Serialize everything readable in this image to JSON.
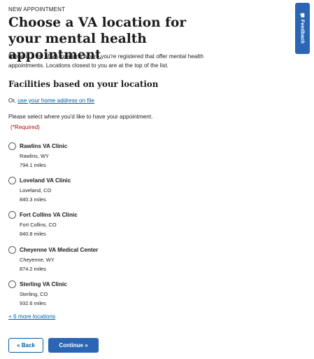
{
  "header": {
    "eyebrow": "NEW APPOINTMENT",
    "title": "Choose a VA location for your mental health appointment",
    "intro": "Below is a list of VA locations where you're registered that offer mental health appointments. Locations closest to you are at the top of the list."
  },
  "section": {
    "title": "Facilities based on your location",
    "or_prefix": "Or, ",
    "home_address_link": "use your home address on file",
    "prompt": "Please select where you'd like to have your appointment.",
    "required": "(*Required)"
  },
  "facilities": [
    {
      "name": "Rawlins VA Clinic",
      "location": "Rawlins, WY",
      "distance": "794.1 miles",
      "selected": false
    },
    {
      "name": "Loveland VA Clinic",
      "location": "Loveland, CO",
      "distance": "840.3 miles",
      "selected": false
    },
    {
      "name": "Fort Collins VA Clinic",
      "location": "Fort Collins, CO",
      "distance": "840.8 miles",
      "selected": false
    },
    {
      "name": "Cheyenne VA Medical Center",
      "location": "Cheyenne, WY",
      "distance": "874.2 miles",
      "selected": false
    },
    {
      "name": "Sterling VA Clinic",
      "location": "Sterling, CO",
      "distance": "932.6 miles",
      "selected": false
    }
  ],
  "more_locations": "+ 6 more locations",
  "buttons": {
    "back": "« Back",
    "continue": "Continue »"
  },
  "feedback": {
    "label": "Feedback",
    "icon": "speech-bubble-icon"
  },
  "colors": {
    "primary": "#2a66b3",
    "link": "#005ea2",
    "required": "#b50909"
  }
}
